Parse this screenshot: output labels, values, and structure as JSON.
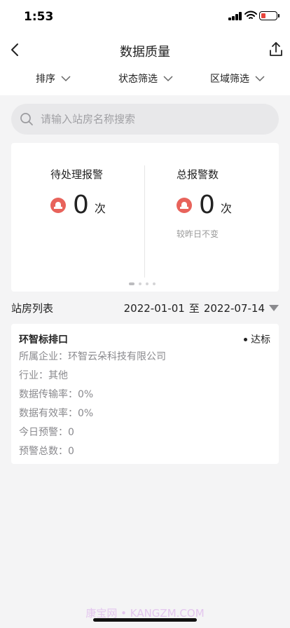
{
  "status_bar": {
    "time": "1:53"
  },
  "nav": {
    "title": "数据质量"
  },
  "filters": [
    {
      "label": "排序"
    },
    {
      "label": "状态筛选"
    },
    {
      "label": "区域筛选"
    }
  ],
  "search": {
    "placeholder": "请输入站房名称搜索",
    "value": ""
  },
  "stats": {
    "pending": {
      "title": "待处理报警",
      "value": "0",
      "unit": "次"
    },
    "total": {
      "title": "总报警数",
      "value": "0",
      "unit": "次",
      "compare": "较昨日不变"
    },
    "pager": {
      "pages": 4,
      "active": 0
    }
  },
  "list": {
    "title": "站房列表",
    "date_start": "2022-01-01",
    "date_sep": "至",
    "date_end": "2022-07-14"
  },
  "stations": [
    {
      "name": "环智标排口",
      "status": "达标",
      "company": "所属企业：环智云朵科技有限公司",
      "industry": "行业：其他",
      "transmission": "数据传输率：0%",
      "validity": "数据有效率：0%",
      "warnings_today": "今日预警：0",
      "warnings_total": "预警总数：0"
    }
  ],
  "watermark": "康宝网 • KANGZM.COM",
  "colors": {
    "alarm": "#e8635b",
    "background": "#f4f4f5",
    "battery": "#e8453c"
  },
  "icons": [
    "back-arrow-icon",
    "share-icon",
    "chevron-down-icon",
    "search-icon",
    "alarm-icon",
    "dropdown-triangle-icon",
    "signal-icon",
    "wifi-icon",
    "battery-icon"
  ]
}
